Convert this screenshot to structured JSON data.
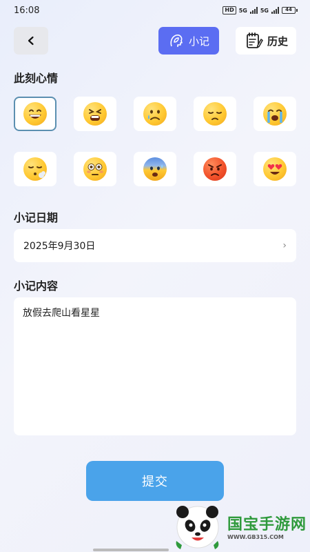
{
  "status_bar": {
    "time": "16:08",
    "hd_label": "HD",
    "signal1_label": "5G",
    "signal2_label": "5G",
    "battery_level": "44"
  },
  "header": {
    "back_icon": "chevron-left-icon",
    "note_button_label": "小记",
    "note_button_icon": "leaf-head-icon",
    "history_button_label": "历史",
    "history_button_icon": "notepad-icon",
    "accent_color": "#5b6df2"
  },
  "mood": {
    "title": "此刻心情",
    "selected_index": 0,
    "emojis": [
      "grinning-face",
      "tired-face",
      "crying-face",
      "pensive-face",
      "loudly-crying-face",
      "sleepy-exhale-face",
      "flushed-face",
      "anxious-face",
      "angry-face",
      "heart-eyes-face"
    ]
  },
  "date_section": {
    "title": "小记日期",
    "value": "2025年9月30日",
    "chevron": "›"
  },
  "content_section": {
    "title": "小记内容",
    "value": "放假去爬山看星星"
  },
  "submit": {
    "label": "提交",
    "color": "#4aa3ea"
  },
  "watermark": {
    "title": "国宝手游网",
    "subtitle": "WWW.GB315.COM"
  }
}
